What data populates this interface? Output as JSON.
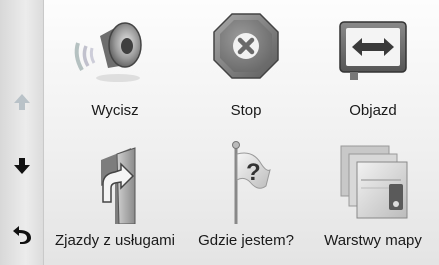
{
  "sidebar": {
    "up_icon": "arrow-up-icon",
    "down_icon": "arrow-down-icon",
    "back_icon": "back-arrow-icon"
  },
  "menu": {
    "items": [
      {
        "label": "Wycisz",
        "icon": "speaker-mute-icon"
      },
      {
        "label": "Stop",
        "icon": "stop-sign-icon"
      },
      {
        "label": "Objazd",
        "icon": "detour-arrows-icon"
      },
      {
        "label": "Zjazdy z usługami",
        "icon": "exit-services-icon"
      },
      {
        "label": "Gdzie jestem?",
        "icon": "where-am-i-flag-icon"
      },
      {
        "label": "Warstwy mapy",
        "icon": "map-layers-icon"
      }
    ]
  },
  "colors": {
    "label_text": "#1a1a1a",
    "arrow_disabled": "#b9c2c8",
    "arrow_active": "#111111"
  }
}
